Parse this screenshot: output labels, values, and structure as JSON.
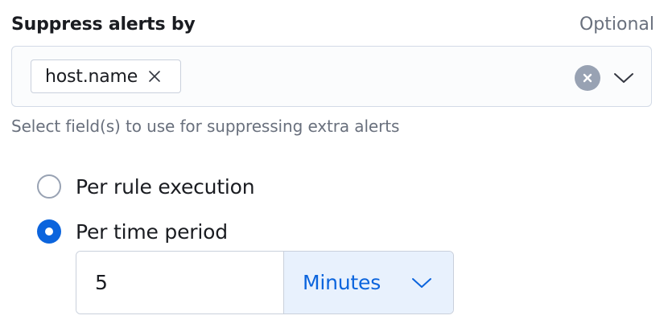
{
  "field": {
    "label": "Suppress alerts by",
    "optional_text": "Optional",
    "selected_fields": [
      {
        "label": "host.name"
      }
    ],
    "help_text": "Select field(s) to use for suppressing extra alerts"
  },
  "suppression_mode": {
    "options": [
      {
        "label": "Per rule execution",
        "checked": false
      },
      {
        "label": "Per time period",
        "checked": true
      }
    ]
  },
  "time_period": {
    "value": "5",
    "unit": "Minutes"
  },
  "colors": {
    "accent": "#0b64dd",
    "unit_background": "#e8f1fd",
    "subdued_text": "#69707d",
    "border": "#d3dae6"
  },
  "icons": {
    "pill_remove": "cross-icon",
    "clear": "clear-circle-icon",
    "dropdown": "chevron-down-icon"
  }
}
